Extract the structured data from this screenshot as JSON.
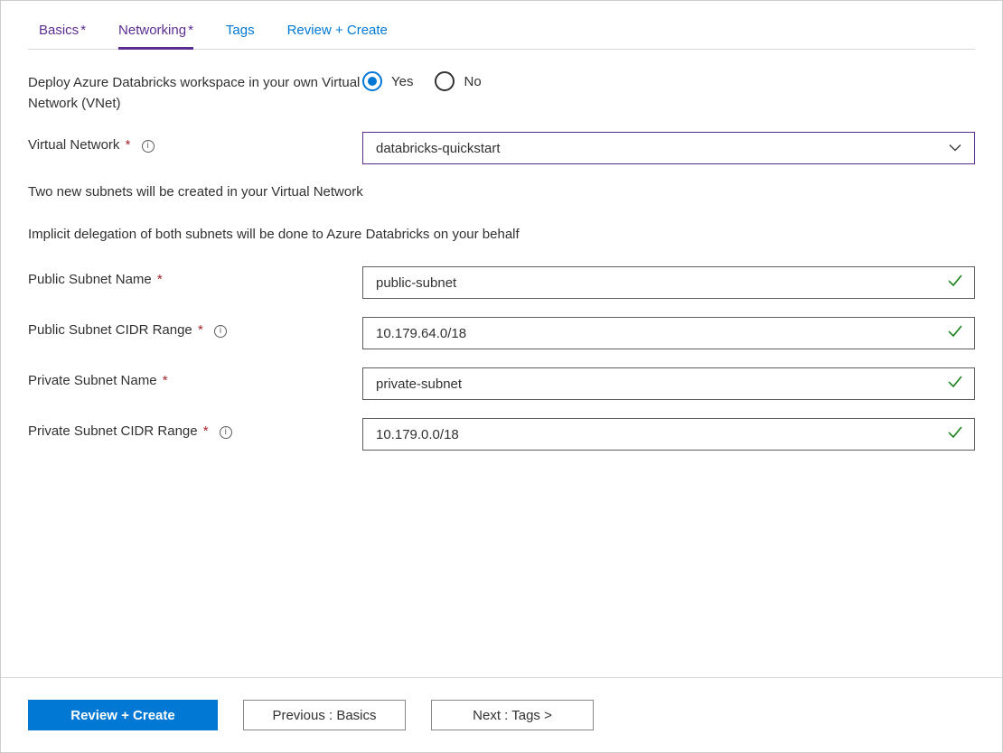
{
  "tabs": [
    {
      "label": "Basics",
      "marker": "*",
      "state": "visited"
    },
    {
      "label": "Networking",
      "marker": "*",
      "state": "active"
    },
    {
      "label": "Tags",
      "marker": "",
      "state": "default"
    },
    {
      "label": "Review + Create",
      "marker": "",
      "state": "default"
    }
  ],
  "deploy_vnet": {
    "label": "Deploy Azure Databricks workspace in your own Virtual Network (VNet)",
    "options": {
      "yes": "Yes",
      "no": "No"
    },
    "selected": "yes"
  },
  "virtual_network": {
    "label": "Virtual Network",
    "value": "databricks-quickstart"
  },
  "info_lines": {
    "line1": "Two new subnets will be created in your Virtual Network",
    "line2": "Implicit delegation of both subnets will be done to Azure Databricks on your behalf"
  },
  "public_subnet_name": {
    "label": "Public Subnet Name",
    "value": "public-subnet"
  },
  "public_subnet_cidr": {
    "label": "Public Subnet CIDR Range",
    "value": "10.179.64.0/18"
  },
  "private_subnet_name": {
    "label": "Private Subnet Name",
    "value": "private-subnet"
  },
  "private_subnet_cidr": {
    "label": "Private Subnet CIDR Range",
    "value": "10.179.0.0/18"
  },
  "footer": {
    "review_create": "Review + Create",
    "previous": "Previous : Basics",
    "next": "Next : Tags >"
  }
}
